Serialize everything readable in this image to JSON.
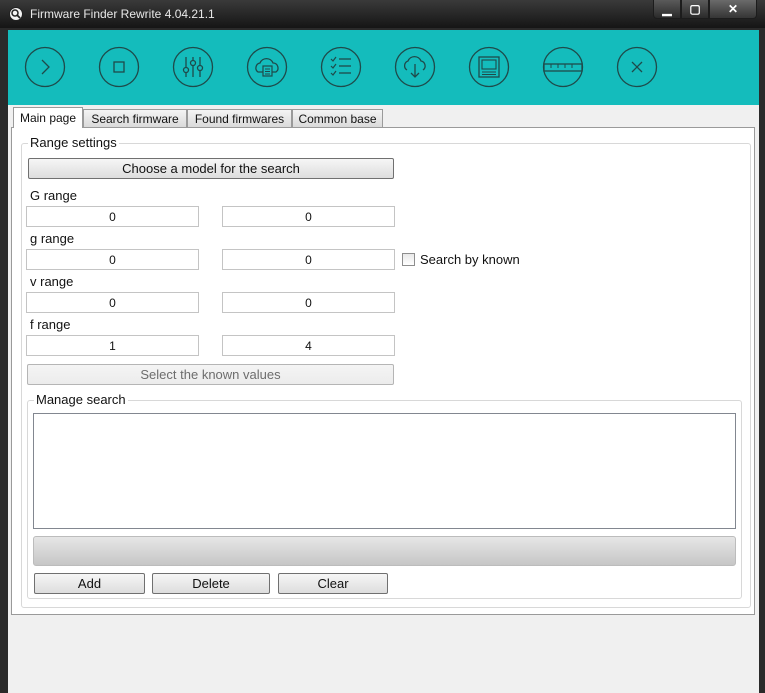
{
  "window": {
    "title": "Firmware Finder Rewrite 4.04.21.1",
    "controls": {
      "minimize": "▁",
      "maximize": "▢",
      "close": "✕"
    }
  },
  "toolbar": {
    "background": "#14bcbc",
    "icons": [
      "play-icon",
      "stop-icon",
      "settings-sliders-icon",
      "cloud-list-icon",
      "checklist-icon",
      "cloud-download-icon",
      "news-icon",
      "ruler-icon",
      "close-icon"
    ]
  },
  "tabs": [
    {
      "label": "Main page",
      "active": true
    },
    {
      "label": "Search firmware",
      "active": false
    },
    {
      "label": "Found firmwares",
      "active": false
    },
    {
      "label": "Common base",
      "active": false
    }
  ],
  "range_settings": {
    "title": "Range settings",
    "choose_model_label": "Choose a model for the search",
    "G": {
      "label": "G range",
      "from": "0",
      "to": "0"
    },
    "g": {
      "label": "g range",
      "from": "0",
      "to": "0"
    },
    "v": {
      "label": "v range",
      "from": "0",
      "to": "0"
    },
    "f": {
      "label": "f range",
      "from": "1",
      "to": "4"
    },
    "search_by_known": {
      "label": "Search by known",
      "checked": false
    },
    "select_known_label": "Select the known values"
  },
  "manage_search": {
    "title": "Manage search",
    "items": [],
    "progress": 0,
    "add_label": "Add",
    "delete_label": "Delete",
    "clear_label": "Clear"
  }
}
